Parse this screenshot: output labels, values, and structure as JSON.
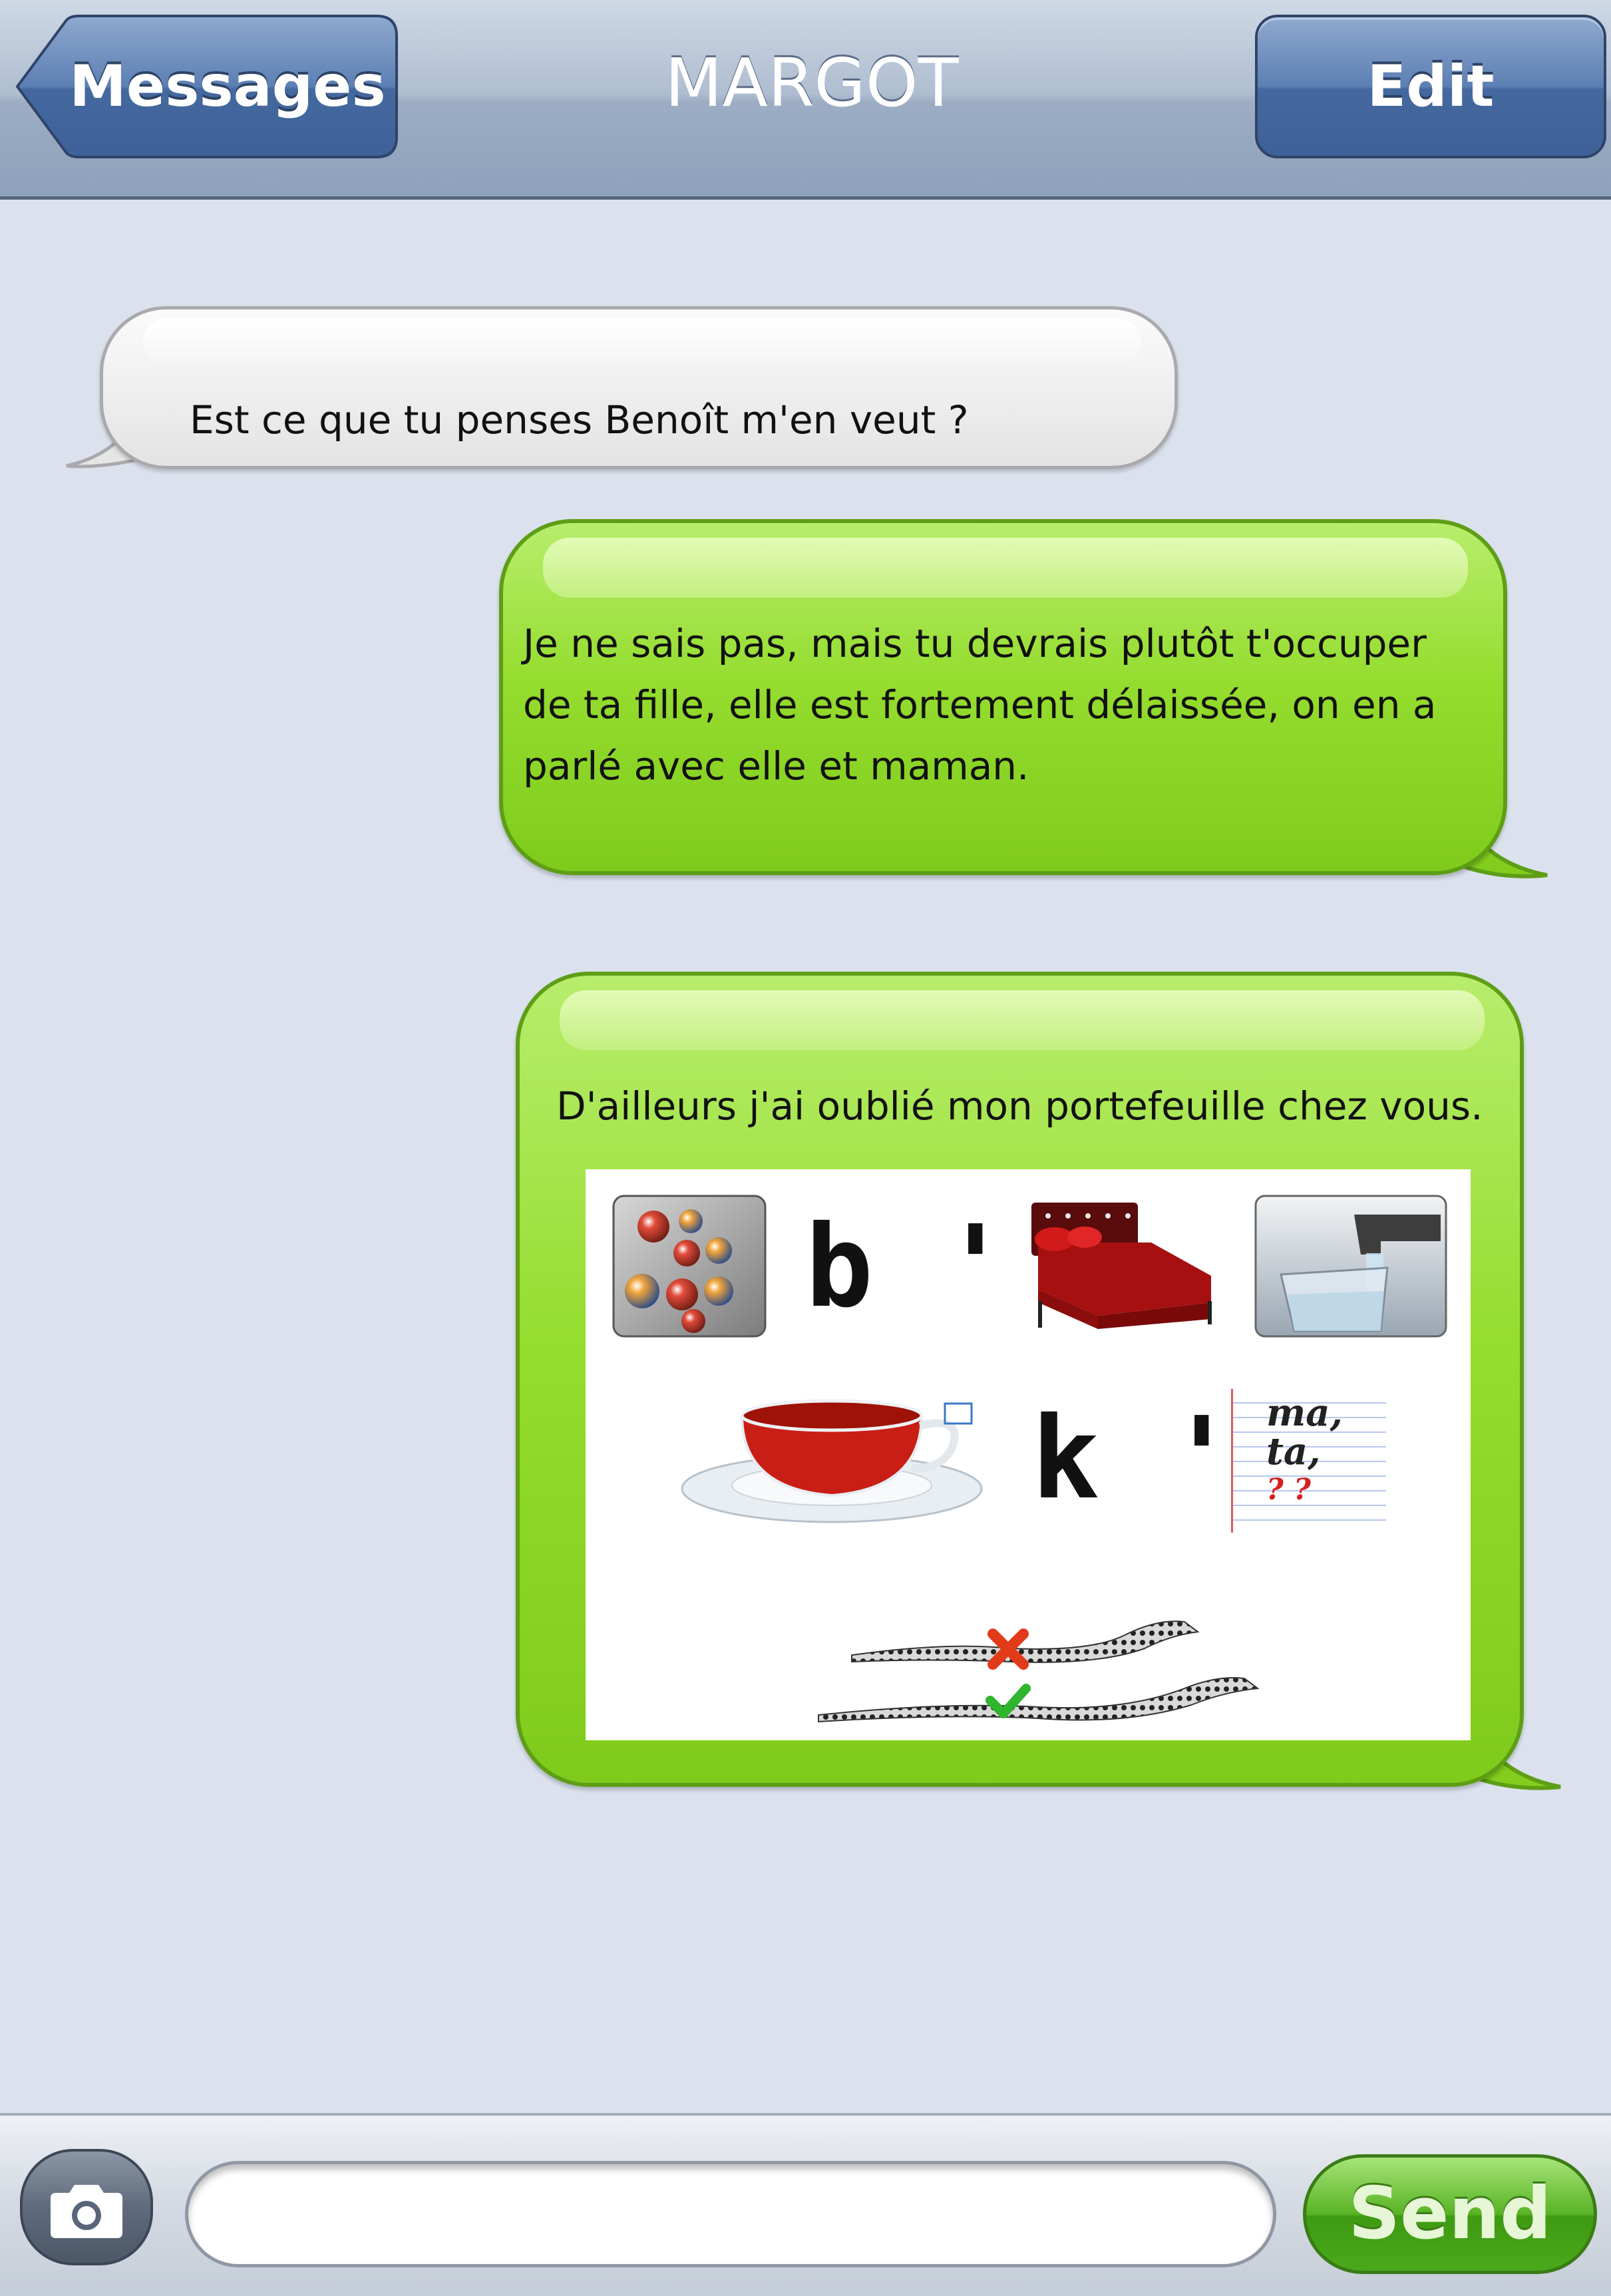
{
  "navbar": {
    "back_label": "Messages",
    "title": "MARGOT",
    "edit_label": "Edit"
  },
  "messages": [
    {
      "direction": "incoming",
      "text": "Est ce que tu penses Benoît m'en veut ?"
    },
    {
      "direction": "outgoing",
      "text": "Je ne sais pas, mais tu devrais plutôt t'occuper de ta fille, elle est fortement délaissée, on en a parlé avec elle et maman."
    },
    {
      "direction": "outgoing",
      "text": "D'ailleurs j'ai oublié mon portefeuille chez vous."
    }
  ],
  "rebus": {
    "row1": {
      "letter": "b '",
      "icons": [
        "marbles-icon",
        "bed-icon",
        "water-glass-icon"
      ]
    },
    "row2": {
      "letter": "k '",
      "notebook_line1": "ma,",
      "notebook_line2": "ta,",
      "notebook_marks": "? ?",
      "icons": [
        "teacup-icon",
        "notebook-icon"
      ]
    },
    "row3": {
      "icons": [
        "snakes-icon",
        "red-cross-icon",
        "green-check-icon"
      ]
    }
  },
  "compose": {
    "input_value": "",
    "send_label": "Send",
    "camera_icon": "camera-icon"
  },
  "colors": {
    "navbar": "#9cadc4",
    "background": "#dbe2ed",
    "outgoing_bubble": "#8fd62a",
    "incoming_bubble": "#eeeeee",
    "send_button": "#59b325"
  }
}
